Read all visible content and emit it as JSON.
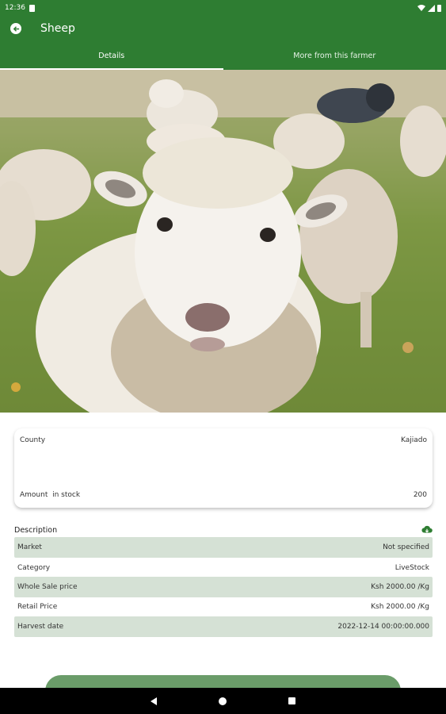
{
  "status_bar": {
    "time": "12:36",
    "icons": [
      "sim-card-icon",
      "wifi-icon",
      "signal-icon",
      "battery-icon"
    ]
  },
  "app_bar": {
    "title": "Sheep",
    "back_icon": "arrow-back-icon",
    "color": "#2e7d32"
  },
  "tabs": [
    {
      "label": "Details",
      "active": true
    },
    {
      "label": "More from this farmer",
      "active": false
    }
  ],
  "hero_image": {
    "subject": "sheep-photo"
  },
  "info_card": {
    "county_label": "County",
    "county_value": "Kajiado",
    "amount_label": "Amount  in stock",
    "amount_value": "200"
  },
  "description": {
    "title": "Description",
    "icon": "cloud-download-icon",
    "rows": [
      {
        "label": "Market",
        "value": "Not specified",
        "shaded": true
      },
      {
        "label": "Category",
        "value": "LiveStock",
        "shaded": false
      },
      {
        "label": "Whole Sale price",
        "value": "Ksh 2000.00 /Kg",
        "shaded": true
      },
      {
        "label": "Retail Price",
        "value": "Ksh 2000.00 /Kg",
        "shaded": false
      },
      {
        "label": "Harvest date",
        "value": "2022-12-14 00:00:00.000",
        "shaded": true
      }
    ]
  },
  "colors": {
    "primary": "#2e7d32",
    "row_shade": "#d5e1d5",
    "button": "#6a9c69"
  },
  "nav_bar": {
    "icons": [
      "nav-back-icon",
      "nav-home-icon",
      "nav-recent-icon"
    ]
  }
}
